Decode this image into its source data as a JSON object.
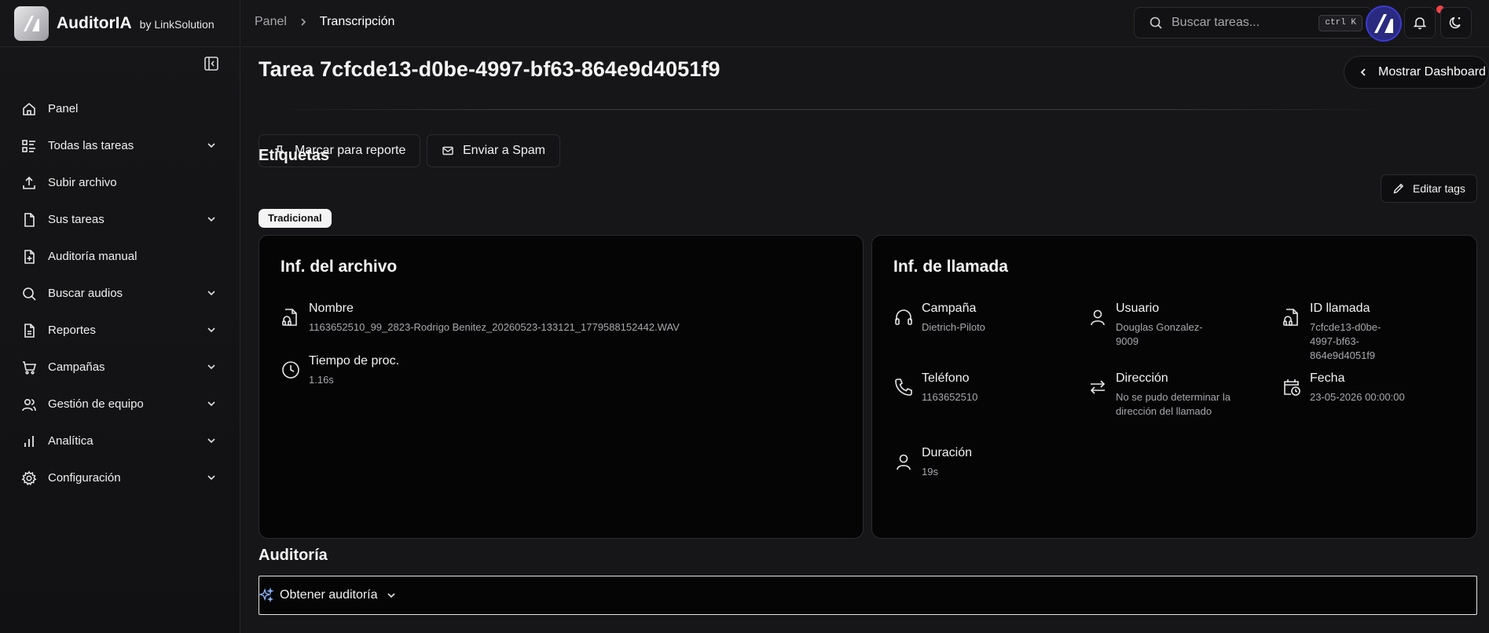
{
  "brand": {
    "name": "AuditorIA",
    "sub": "by LinkSolution",
    "logo_text": "/A"
  },
  "sidebar": {
    "items": [
      {
        "label": "Panel",
        "icon": "home-icon",
        "has_chevron": false
      },
      {
        "label": "Todas las tareas",
        "icon": "list-icon",
        "has_chevron": true
      },
      {
        "label": "Subir archivo",
        "icon": "upload-icon",
        "has_chevron": false
      },
      {
        "label": "Sus tareas",
        "icon": "file-icon",
        "has_chevron": true
      },
      {
        "label": "Auditoría manual",
        "icon": "file-plus-icon",
        "has_chevron": false
      },
      {
        "label": "Buscar audios",
        "icon": "search-icon",
        "has_chevron": true
      },
      {
        "label": "Reportes",
        "icon": "report-icon",
        "has_chevron": true
      },
      {
        "label": "Campañas",
        "icon": "cart-icon",
        "has_chevron": true
      },
      {
        "label": "Gestión de equipo",
        "icon": "users-icon",
        "has_chevron": true
      },
      {
        "label": "Analítica",
        "icon": "bar-chart-icon",
        "has_chevron": true
      },
      {
        "label": "Configuración",
        "icon": "gear-icon",
        "has_chevron": true
      }
    ]
  },
  "topbar": {
    "breadcrumb": [
      "Panel",
      "Transcripción"
    ],
    "search_placeholder": "Buscar tareas...",
    "shortcut": "ctrl K"
  },
  "main": {
    "title": "Tarea 7cfcde13-d0be-4997-bf63-864e9d4051f9",
    "dashboard_button": "Mostrar Dashboard",
    "mark_report_button": "Marcar para reporte",
    "send_spam_button": "Enviar a Spam",
    "tags_title": "Etiquetas",
    "edit_tags_button": "Editar tags",
    "tags": [
      "Tradicional"
    ],
    "file_card": {
      "title": "Inf. del archivo",
      "fields": [
        {
          "label": "Nombre",
          "value": "1163652510_99_2823-Rodrigo Benitez_20260523-133121_1779588152442.WAV",
          "icon": "file-audio-icon"
        },
        {
          "label": "Tiempo de proc.",
          "value": "1.16s",
          "icon": "clock-icon"
        }
      ]
    },
    "call_card": {
      "title": "Inf. de llamada",
      "fields": [
        {
          "label": "Campaña",
          "lines": [
            "Dietrich-Piloto"
          ],
          "icon": "headphones-icon"
        },
        {
          "label": "Usuario",
          "lines": [
            "Douglas Gonzalez-",
            "9009"
          ],
          "icon": "user-icon"
        },
        {
          "label": "ID llamada",
          "lines": [
            "7cfcde13-d0be-",
            "4997-bf63-",
            "864e9d4051f9"
          ],
          "icon": "file-audio-icon"
        },
        {
          "label": "Teléfono",
          "lines": [
            "1163652510"
          ],
          "icon": "phone-icon"
        },
        {
          "label": "Dirección",
          "lines": [
            "No se pudo determinar la",
            "dirección del llamado"
          ],
          "icon": "arrows-icon"
        },
        {
          "label": "Fecha",
          "lines": [
            "23-05-2026 00:00:00"
          ],
          "icon": "calendar-clock-icon"
        },
        {
          "label": "Duración",
          "lines": [
            "19s"
          ],
          "icon": "user-icon"
        }
      ]
    },
    "audit_title": "Auditoría",
    "audit_button": "Obtener auditoría"
  },
  "colors": {
    "background": "#161618",
    "card": "#050506",
    "border": "#2c2c31",
    "notification": "#ef4444",
    "avatar": "#2a2a80"
  }
}
